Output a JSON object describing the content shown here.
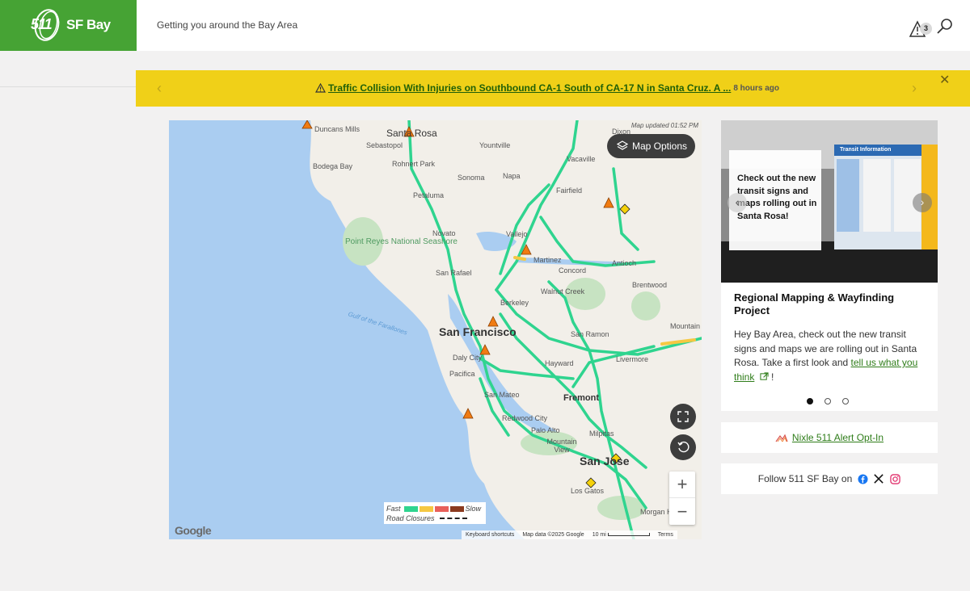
{
  "header": {
    "logo_num": "511",
    "logo_text": "SF Bay",
    "tagline": "Getting you around the Bay Area",
    "alert_count": "3"
  },
  "banner": {
    "message": "Traffic Collision With Injuries on Southbound CA-1 South of CA-17 N in Santa Cruz. A ...",
    "time": "8 hours ago"
  },
  "map": {
    "updated": "Map updated 01:52 PM",
    "options_label": "Map Options",
    "labels": {
      "santa_rosa": "Santa Rosa",
      "duncans_mills": "Duncans Mills",
      "sebastopol": "Sebastopol",
      "yountville": "Yountville",
      "vacaville": "Vacaville",
      "dixon": "Dixon",
      "bodega_bay": "Bodega Bay",
      "rohnert_park": "Rohnert Park",
      "sonoma": "Sonoma",
      "napa": "Napa",
      "fairfield": "Fairfield",
      "petaluma": "Petaluma",
      "novato": "Novato",
      "vallejo": "Vallejo",
      "point_reyes": "Point Reyes National Seashore",
      "martinez": "Martinez",
      "concord": "Concord",
      "antioch": "Antioch",
      "san_rafael": "San Rafael",
      "brentwood": "Brentwood",
      "walnut_creek": "Walnut Creek",
      "berkeley": "Berkeley",
      "gulf": "Gulf of the Farallones",
      "san_francisco": "San Francisco",
      "san_ramon": "San Ramon",
      "mountain_house": "Mountain House",
      "daly_city": "Daly City",
      "hayward": "Hayward",
      "livermore": "Livermore",
      "pacifica": "Pacifica",
      "san_mateo": "San Mateo",
      "fremont": "Fremont",
      "redwood_city": "Redwood City",
      "palo_alto": "Palo Alto",
      "milpitas": "Milpitas",
      "mountain_view": "Mountain View",
      "san_jose": "San Jose",
      "los_gatos": "Los Gatos",
      "morgan_hill": "Morgan Hill"
    },
    "legend": {
      "fast": "Fast",
      "slow": "Slow",
      "closures": "Road Closures"
    },
    "legend_colors": [
      "#2fd48f",
      "#f5c842",
      "#e8605a",
      "#8b3a1e"
    ],
    "google": "Google",
    "attribution": {
      "keyboard": "Keyboard shortcuts",
      "data": "Map data ©2025 Google",
      "scale": "10 mi",
      "terms": "Terms"
    },
    "zoom_in": "+",
    "zoom_out": "−"
  },
  "card": {
    "image_text": "Check out the new transit signs and maps rolling out in Santa Rosa!",
    "sign_title": "Transit Information",
    "title": "Regional Mapping & Wayfinding Project",
    "body_pre": "Hey Bay Area, check out the new transit signs and maps we are rolling out in Santa Rosa. Take a first look and ",
    "body_link": "tell us what you think",
    "body_post": " !"
  },
  "nixle": {
    "label": "Nixle 511 Alert Opt-In"
  },
  "follow": {
    "label": "Follow 511 SF Bay on"
  },
  "colors": {
    "brand_green": "#46a334",
    "banner_yellow": "#f0d018",
    "link_green": "#2f7d1a"
  }
}
